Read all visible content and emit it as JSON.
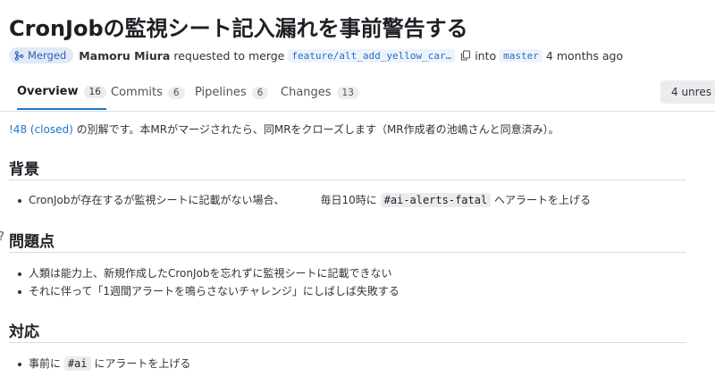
{
  "mr": {
    "title": "CronJobの監視シート記入漏れを事前警告する",
    "status_badge": "Merged",
    "author": "Mamoru Miura",
    "requested_text": "requested to merge",
    "source_branch": "feature/alt_add_yellow_car…",
    "into_text": "into",
    "target_branch": "master",
    "time_ago": "4 months ago"
  },
  "tabs": [
    {
      "label": "Overview",
      "count": "16",
      "active": true
    },
    {
      "label": "Commits",
      "count": "6"
    },
    {
      "label": "Pipelines",
      "count": "6"
    },
    {
      "label": "Changes",
      "count": "13"
    }
  ],
  "unresolved_button": "4 unres",
  "description": {
    "intro_link": "!48 (closed)",
    "intro_text": " の別解です。本MRがマージされたら、同MRをクローズします（MR作成者の池嶋さんと同意済み）。",
    "sections": [
      {
        "heading": "背景",
        "items": [
          {
            "pre": "CronJobが存在するが監視シートに記載がない場合、",
            "mid": "毎日10時に ",
            "code": "#ai-alerts-fatal",
            "post": " へアラートを上げる"
          }
        ]
      },
      {
        "heading": "問題点",
        "items": [
          {
            "text": "人類は能力上、新規作成したCronJobを忘れずに監視シートに記載できない"
          },
          {
            "text": "それに伴って「1週間アラートを鳴らさないチャレンジ」にしばしば失敗する"
          }
        ]
      },
      {
        "heading": "対応",
        "items": [
          {
            "pre": "事前に ",
            "code": "#ai",
            "post": " にアラートを上げる"
          }
        ]
      }
    ]
  },
  "colors": {
    "accent": "#1f75cb",
    "merged_badge_bg": "#e1e8f8",
    "merged_badge_text": "#2f5fb3"
  },
  "icons": {
    "merge": "merge-icon",
    "copy": "copy-icon",
    "anchor": "link-anchor-icon"
  }
}
